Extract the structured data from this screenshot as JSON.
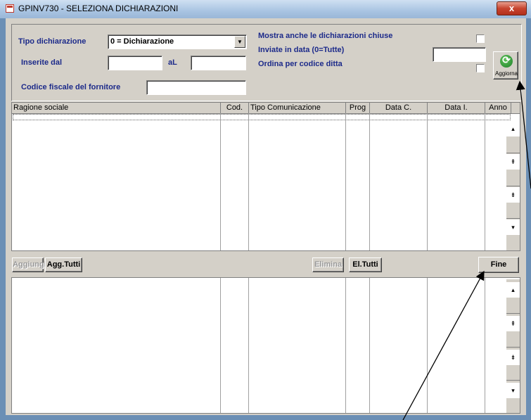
{
  "window": {
    "title": "GPINV730 - SELEZIONA DICHIARAZIONI",
    "close_label": "x"
  },
  "form": {
    "tipo_label": "Tipo dichiarazione",
    "tipo_value": "0 = Dichiarazione",
    "inserite_label": "Inserite dal",
    "inserite_dal_value": "",
    "al_label": "aL",
    "al_value": "",
    "codice_label": "Codice fiscale del fornitore",
    "codice_value": "",
    "mostra_label": "Mostra anche le dichiarazioni chiuse",
    "inviate_label": "Inviate in data (0=Tutte)",
    "inviate_value": "",
    "ordina_label": "Ordina per codice ditta",
    "refresh_label": "Aggiorna"
  },
  "table": {
    "columns": [
      "Ragione sociale",
      "Cod.",
      "Tipo Comunicazione",
      "Prog",
      "Data C.",
      "Data I.",
      "Anno"
    ],
    "rows": []
  },
  "buttons": {
    "aggiungi": "Aggiungi",
    "agg_tutti": "Agg.Tutti",
    "elimina": "Elimina",
    "el_tutti": "El.Tutti",
    "fine": "Fine"
  },
  "icons": {
    "scroll_up": "▴",
    "scroll_down": "▾",
    "page_up": "⇞",
    "page_down": "⇟"
  }
}
